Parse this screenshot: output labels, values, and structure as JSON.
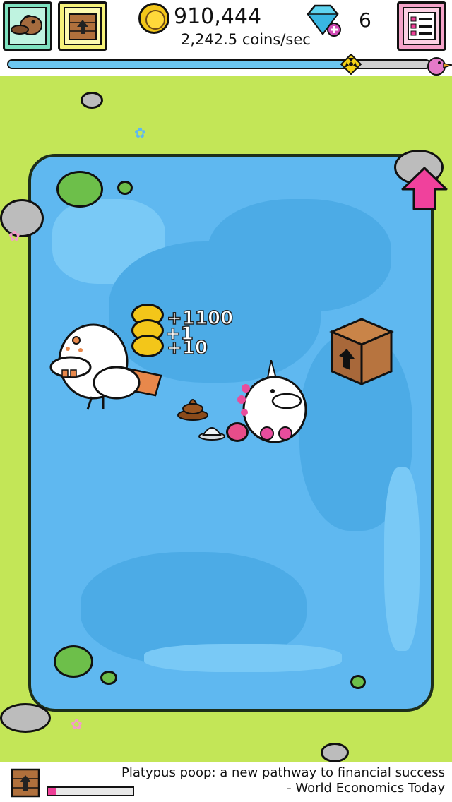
{
  "hud": {
    "coins": "910,444",
    "rate": "2,242.5 coins/sec",
    "gems": "6",
    "evolutions_icon": "platypus-portrait-icon",
    "boxes_icon": "crate-icon",
    "menu_icon": "list-menu-icon"
  },
  "progress": {
    "fraction": 0.82,
    "marker_icon": "radiation-icon",
    "goal_icon": "pink-bird-icon"
  },
  "field": {
    "floating": [
      "+1100",
      "+1",
      "+10"
    ],
    "upgrade_arrow_icon": "pink-up-arrow-icon"
  },
  "bottom": {
    "box_progress": 0.1,
    "quote_line1": "Platypus poop: a new pathway to financial success",
    "quote_line2": "- World Economics Today"
  },
  "colors": {
    "grass": "#c3e657",
    "water": "#5fb8f0",
    "accent_pink": "#ee3f97",
    "coin": "#f3c619"
  }
}
